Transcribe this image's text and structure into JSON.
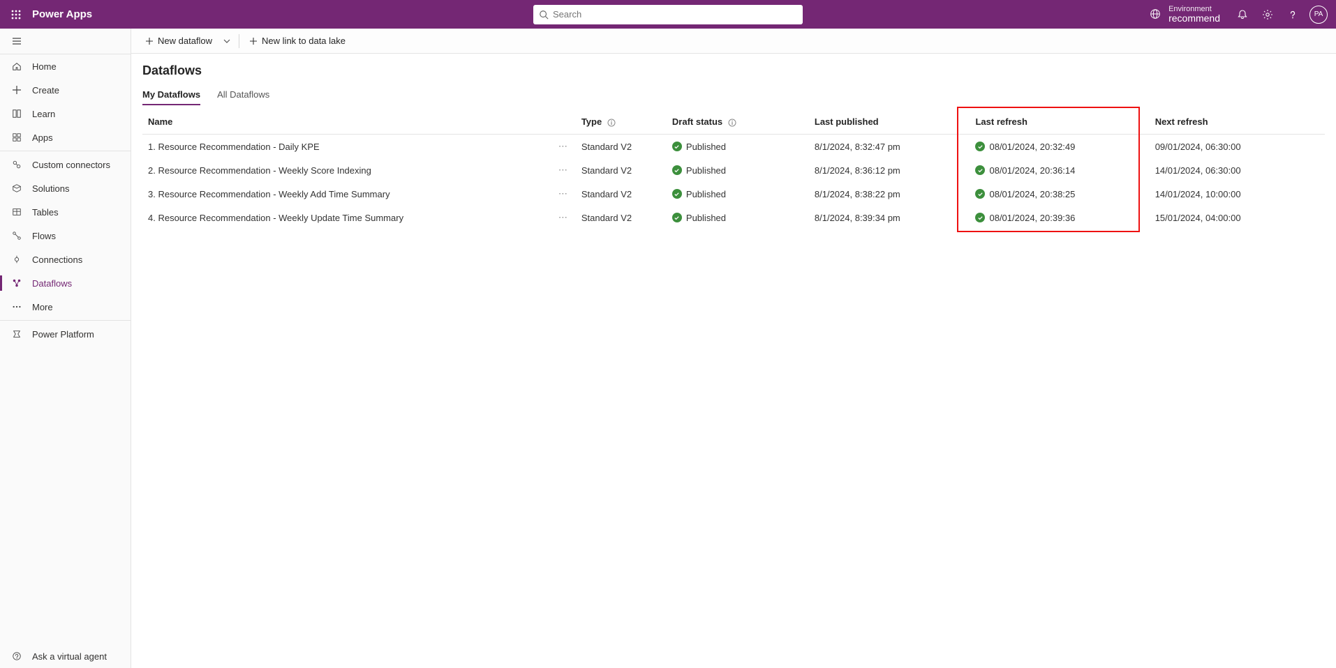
{
  "topbar": {
    "app_title": "Power Apps",
    "search_placeholder": "Search",
    "env_label": "Environment",
    "env_name": "recommend",
    "avatar_initials": "PA"
  },
  "sidebar": {
    "items": [
      {
        "id": "home",
        "label": "Home"
      },
      {
        "id": "create",
        "label": "Create"
      },
      {
        "id": "learn",
        "label": "Learn"
      },
      {
        "id": "apps",
        "label": "Apps"
      }
    ],
    "items2": [
      {
        "id": "connectors",
        "label": "Custom connectors"
      },
      {
        "id": "solutions",
        "label": "Solutions"
      },
      {
        "id": "tables",
        "label": "Tables"
      },
      {
        "id": "flows",
        "label": "Flows"
      },
      {
        "id": "connections",
        "label": "Connections"
      },
      {
        "id": "dataflows",
        "label": "Dataflows"
      },
      {
        "id": "more",
        "label": "More"
      }
    ],
    "items3": [
      {
        "id": "platform",
        "label": "Power Platform"
      }
    ],
    "ask_agent": "Ask a virtual agent"
  },
  "commandbar": {
    "new_dataflow": "New dataflow",
    "new_link": "New link to data lake"
  },
  "page": {
    "title": "Dataflows",
    "tabs": {
      "mine": "My Dataflows",
      "all": "All Dataflows"
    }
  },
  "table": {
    "headers": {
      "name": "Name",
      "type": "Type",
      "draft": "Draft status",
      "published": "Last published",
      "last_refresh": "Last refresh",
      "next_refresh": "Next refresh"
    },
    "rows": [
      {
        "name": "1. Resource Recommendation - Daily KPE",
        "type": "Standard V2",
        "draft": "Published",
        "published": "8/1/2024, 8:32:47 pm",
        "last_refresh": "08/01/2024, 20:32:49",
        "next_refresh": "09/01/2024, 06:30:00"
      },
      {
        "name": "2. Resource Recommendation - Weekly Score Indexing",
        "type": "Standard V2",
        "draft": "Published",
        "published": "8/1/2024, 8:36:12 pm",
        "last_refresh": "08/01/2024, 20:36:14",
        "next_refresh": "14/01/2024, 06:30:00"
      },
      {
        "name": "3. Resource Recommendation - Weekly Add Time Summary",
        "type": "Standard V2",
        "draft": "Published",
        "published": "8/1/2024, 8:38:22 pm",
        "last_refresh": "08/01/2024, 20:38:25",
        "next_refresh": "14/01/2024, 10:00:00"
      },
      {
        "name": "4. Resource Recommendation - Weekly Update Time Summary",
        "type": "Standard V2",
        "draft": "Published",
        "published": "8/1/2024, 8:39:34 pm",
        "last_refresh": "08/01/2024, 20:39:36",
        "next_refresh": "15/01/2024, 04:00:00"
      }
    ]
  }
}
